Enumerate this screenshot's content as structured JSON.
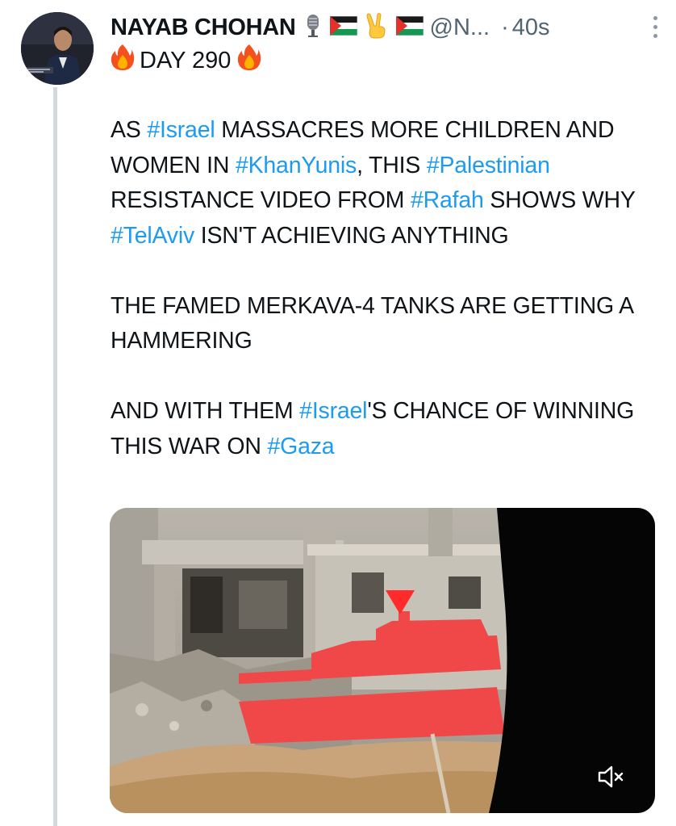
{
  "post": {
    "author_name": "NAYAB CHOHAN",
    "handle": "@N...",
    "separator": "·",
    "time": "40s",
    "day_text": "DAY 290",
    "paragraphs": [
      [
        {
          "t": "AS ",
          "tag": false
        },
        {
          "t": "#Israel",
          "tag": true
        },
        {
          "t": " MASSACRES MORE CHILDREN AND WOMEN IN ",
          "tag": false
        },
        {
          "t": "#KhanYunis",
          "tag": true
        },
        {
          "t": ", THIS ",
          "tag": false
        },
        {
          "t": "#Palestinian",
          "tag": true
        },
        {
          "t": " RESISTANCE VIDEO FROM ",
          "tag": false
        },
        {
          "t": "#Rafah",
          "tag": true
        },
        {
          "t": " SHOWS WHY ",
          "tag": false
        },
        {
          "t": "#TelAviv",
          "tag": true
        },
        {
          "t": " ISN'T ACHIEVING ANYTHING",
          "tag": false
        }
      ],
      [
        {
          "t": "THE FAMED MERKAVA-4 TANKS ARE GETTING A HAMMERING",
          "tag": false
        }
      ],
      [
        {
          "t": "AND WITH THEM ",
          "tag": false
        },
        {
          "t": "#Israel",
          "tag": true
        },
        {
          "t": "'S CHANCE OF WINNING THIS WAR ON ",
          "tag": false
        },
        {
          "t": "#Gaza",
          "tag": true
        }
      ]
    ]
  },
  "icons": {
    "name_emojis": [
      "microphone-icon",
      "palestine-flag-icon",
      "victory-hand-icon",
      "palestine-flag-icon"
    ],
    "day_emojis": [
      "fire-icon",
      "fire-icon"
    ],
    "more": "more-options-icon",
    "mute": "muted-speaker-icon"
  },
  "colors": {
    "text": "#0f1419",
    "secondary": "#536471",
    "link": "#1d9bf0",
    "thread_line": "#cfd9de",
    "tank_highlight": "#f04848"
  }
}
